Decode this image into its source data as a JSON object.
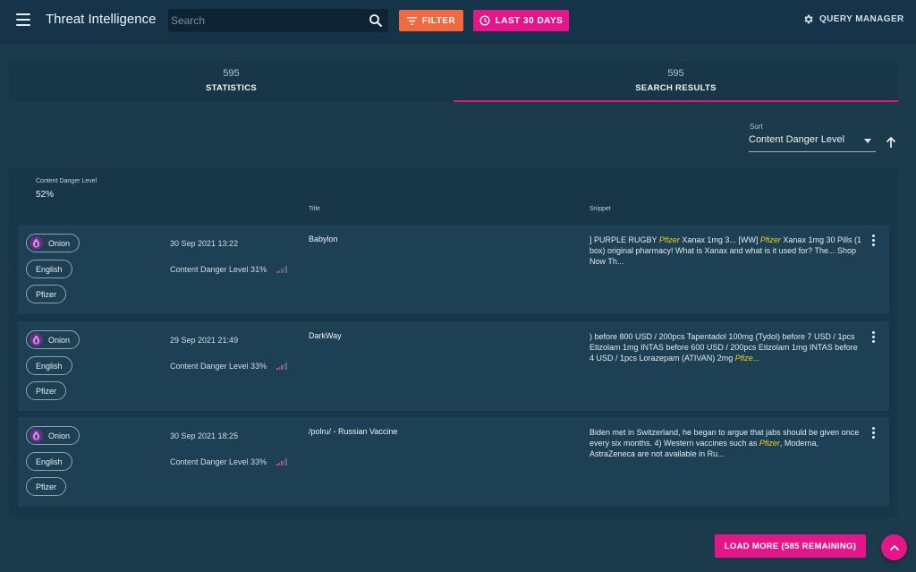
{
  "app": {
    "title": "Threat Intelligence",
    "search_placeholder": "Search",
    "filter_label": "FILTER",
    "date_range_label": "LAST 30 DAYS",
    "query_manager_label": "QUERY MANAGER"
  },
  "tabs": [
    {
      "count": "595",
      "label": "STATISTICS",
      "active": false
    },
    {
      "count": "595",
      "label": "SEARCH RESULTS",
      "active": true
    }
  ],
  "sort": {
    "label": "Sort",
    "value": "Content Danger Level"
  },
  "summary": {
    "heading": "Content Danger Level",
    "value": "52%"
  },
  "columns": {
    "title": "Title",
    "snippet": "Snippet"
  },
  "results": [
    {
      "source": "Onion",
      "language": "English",
      "entity": "Pfizer",
      "date": "30 Sep 2021 13:22",
      "danger_label": "Content Danger Level 31%",
      "danger_level": 0.31,
      "title": "Babylon",
      "snippet": [
        {
          "t": "] PURPLE RUGBY "
        },
        {
          "t": "Pfizer",
          "hl": true
        },
        {
          "t": " Xanax 1mg 3... [WW] "
        },
        {
          "t": "Pfizer",
          "hl": true
        },
        {
          "t": " Xanax 1mg 30 Pills (1 box) original pharmacy! What is Xanax and what is it used for? The... Shop Now Th..."
        }
      ]
    },
    {
      "source": "Onion",
      "language": "English",
      "entity": "Pfizer",
      "date": "29 Sep 2021 21:49",
      "danger_label": "Content Danger Level 33%",
      "danger_level": 0.33,
      "title": "DarkWay",
      "snippet": [
        {
          "t": ") before 800 USD / 200pcs Tapentadol 100mg (Tydol) before 7 USD / 1pcs Etizolam 1mg INTAS before 600 USD / 200pcs Etizolam 1mg INTAS before 4 USD / 1pcs Lorazepam (ATIVAN) 2mg "
        },
        {
          "t": "Pfize...",
          "hl": true
        }
      ]
    },
    {
      "source": "Onion",
      "language": "English",
      "entity": "Pfizer",
      "date": "30 Sep 2021 18:25",
      "danger_label": "Content Danger Level 33%",
      "danger_level": 0.33,
      "title": "/polru/ - Russian Vaccine",
      "snippet": [
        {
          "t": "Biden met in Switzerland, he began to argue that jabs should be given once every six months. 4) Western vaccines such as "
        },
        {
          "t": "Pfizer",
          "hl": true
        },
        {
          "t": ", Moderna, AstraZeneca are not available in Ru..."
        }
      ]
    }
  ],
  "load_more_label": "LOAD MORE (585 REMAINING)",
  "colors": {
    "accent": "#e5168a",
    "filter": "#f16a3f",
    "highlight": "#f2cf1f",
    "onion": "#6a2d86"
  },
  "icons": {
    "menu": "menu-icon",
    "search": "search-icon",
    "filter": "filter-icon",
    "clock": "clock-icon",
    "gear": "gear-icon",
    "sort_direction": "arrow-up-icon",
    "onion": "onion-icon",
    "danger": "signal-bars-icon",
    "more": "more-vert-icon",
    "scroll_top": "chevron-up-icon"
  }
}
